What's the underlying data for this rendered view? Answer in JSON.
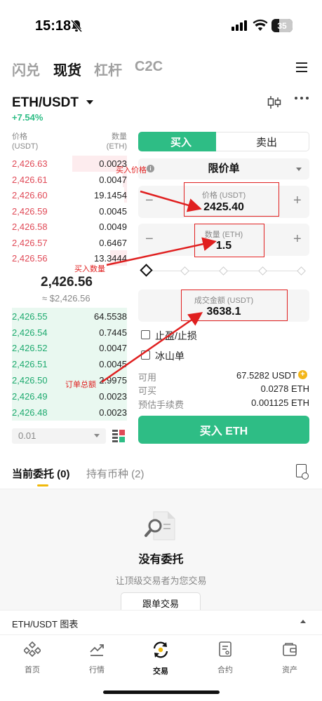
{
  "status_bar": {
    "time": "15:18",
    "battery": "35"
  },
  "top_tabs": [
    {
      "label": "闪兑"
    },
    {
      "label": "现货"
    },
    {
      "label": "杠杆"
    },
    {
      "label": "C2C"
    }
  ],
  "pair": {
    "name": "ETH/USDT",
    "change": "+7.54%"
  },
  "orderbook": {
    "price_header": "价格",
    "price_unit": "(USDT)",
    "qty_header": "数量",
    "qty_unit": "(ETH)",
    "asks": [
      {
        "price": "2,426.63",
        "qty": "0.0023"
      },
      {
        "price": "2,426.61",
        "qty": "0.0047"
      },
      {
        "price": "2,426.60",
        "qty": "19.1454"
      },
      {
        "price": "2,426.59",
        "qty": "0.0045"
      },
      {
        "price": "2,426.58",
        "qty": "0.0049"
      },
      {
        "price": "2,426.57",
        "qty": "0.6467"
      },
      {
        "price": "2,426.56",
        "qty": "13.3444"
      }
    ],
    "mid_price": "2,426.56",
    "mid_usd": "≈ $2,426.56",
    "bids": [
      {
        "price": "2,426.55",
        "qty": "64.5538"
      },
      {
        "price": "2,426.54",
        "qty": "0.7445"
      },
      {
        "price": "2,426.52",
        "qty": "0.0047"
      },
      {
        "price": "2,426.51",
        "qty": "0.0045"
      },
      {
        "price": "2,426.50",
        "qty": "2.9975"
      },
      {
        "price": "2,426.49",
        "qty": "0.0023"
      },
      {
        "price": "2,426.48",
        "qty": "0.0023"
      }
    ],
    "depth": "0.01"
  },
  "trade_form": {
    "buy_tab": "买入",
    "sell_tab": "卖出",
    "order_type": "限价单",
    "price_label": "价格 (USDT)",
    "price_value": "2425.40",
    "qty_label": "数量 (ETH)",
    "qty_value": "1.5",
    "amount_label": "成交金额 (USDT)",
    "amount_value": "3638.1",
    "tp_sl": "止盈/止损",
    "iceberg": "冰山单",
    "available_label": "可用",
    "available_value": "67.5282 USDT",
    "can_buy_label": "可买",
    "can_buy_value": "0.0278 ETH",
    "fee_label": "预估手续费",
    "fee_value": "0.001125 ETH",
    "submit": "买入 ETH"
  },
  "orders": {
    "tab_open": "当前委托 (0)",
    "tab_holdings": "持有币种 (2)",
    "empty_title": "没有委托",
    "empty_sub": "让顶级交易者为您交易",
    "copy_trade": "跟单交易"
  },
  "chart_bar": {
    "label": "ETH/USDT 图表"
  },
  "bottom_nav": [
    {
      "label": "首页",
      "icon": "home-icon"
    },
    {
      "label": "行情",
      "icon": "market-icon"
    },
    {
      "label": "交易",
      "icon": "trade-icon"
    },
    {
      "label": "合约",
      "icon": "futures-icon"
    },
    {
      "label": "资产",
      "icon": "assets-icon"
    }
  ],
  "annotations": {
    "buy_price": "买入价格",
    "buy_qty": "买入数量",
    "order_total": "订单总额"
  },
  "colors": {
    "buy_green": "#2ebd85",
    "ask_red": "#e04a57",
    "annotation_red": "#e02020",
    "accent_yellow": "#f0b90b"
  }
}
